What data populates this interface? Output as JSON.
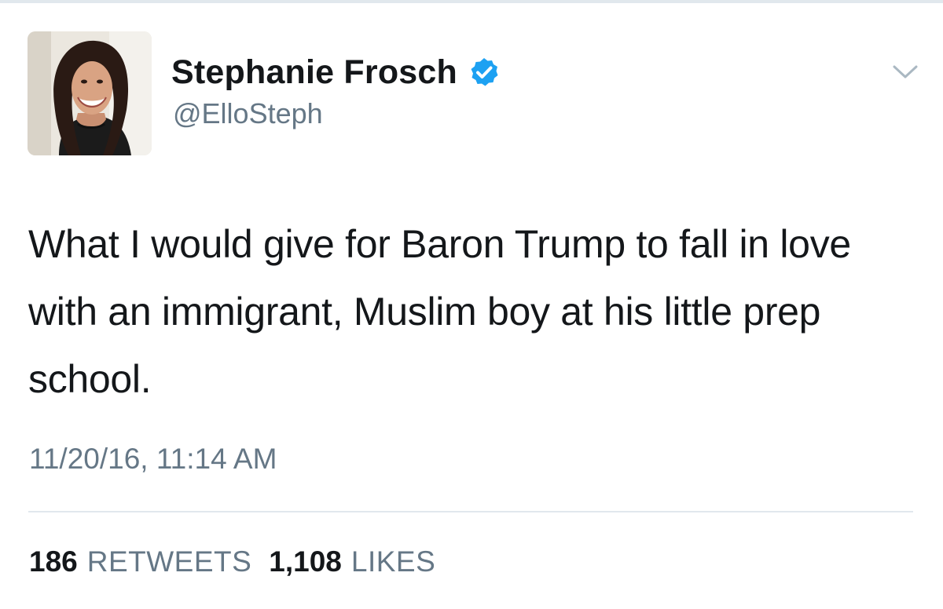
{
  "tweet": {
    "author": {
      "display_name": "Stephanie Frosch",
      "handle": "@ElloSteph",
      "verified": true,
      "avatar": "profile-photo"
    },
    "text": "What I would give for Baron Trump to fall in love with an immigrant, Muslim boy at his little prep school.",
    "timestamp": "11/20/16, 11:14 AM",
    "stats": {
      "retweets_count": "186",
      "retweets_label": "RETWEETS",
      "likes_count": "1,108",
      "likes_label": "LIKES"
    },
    "menu_icon": "chevron-down-icon"
  },
  "colors": {
    "primary_text": "#14171a",
    "secondary_text": "#657786",
    "verified_blue": "#1da1f2",
    "divider": "#e1e8ed"
  }
}
